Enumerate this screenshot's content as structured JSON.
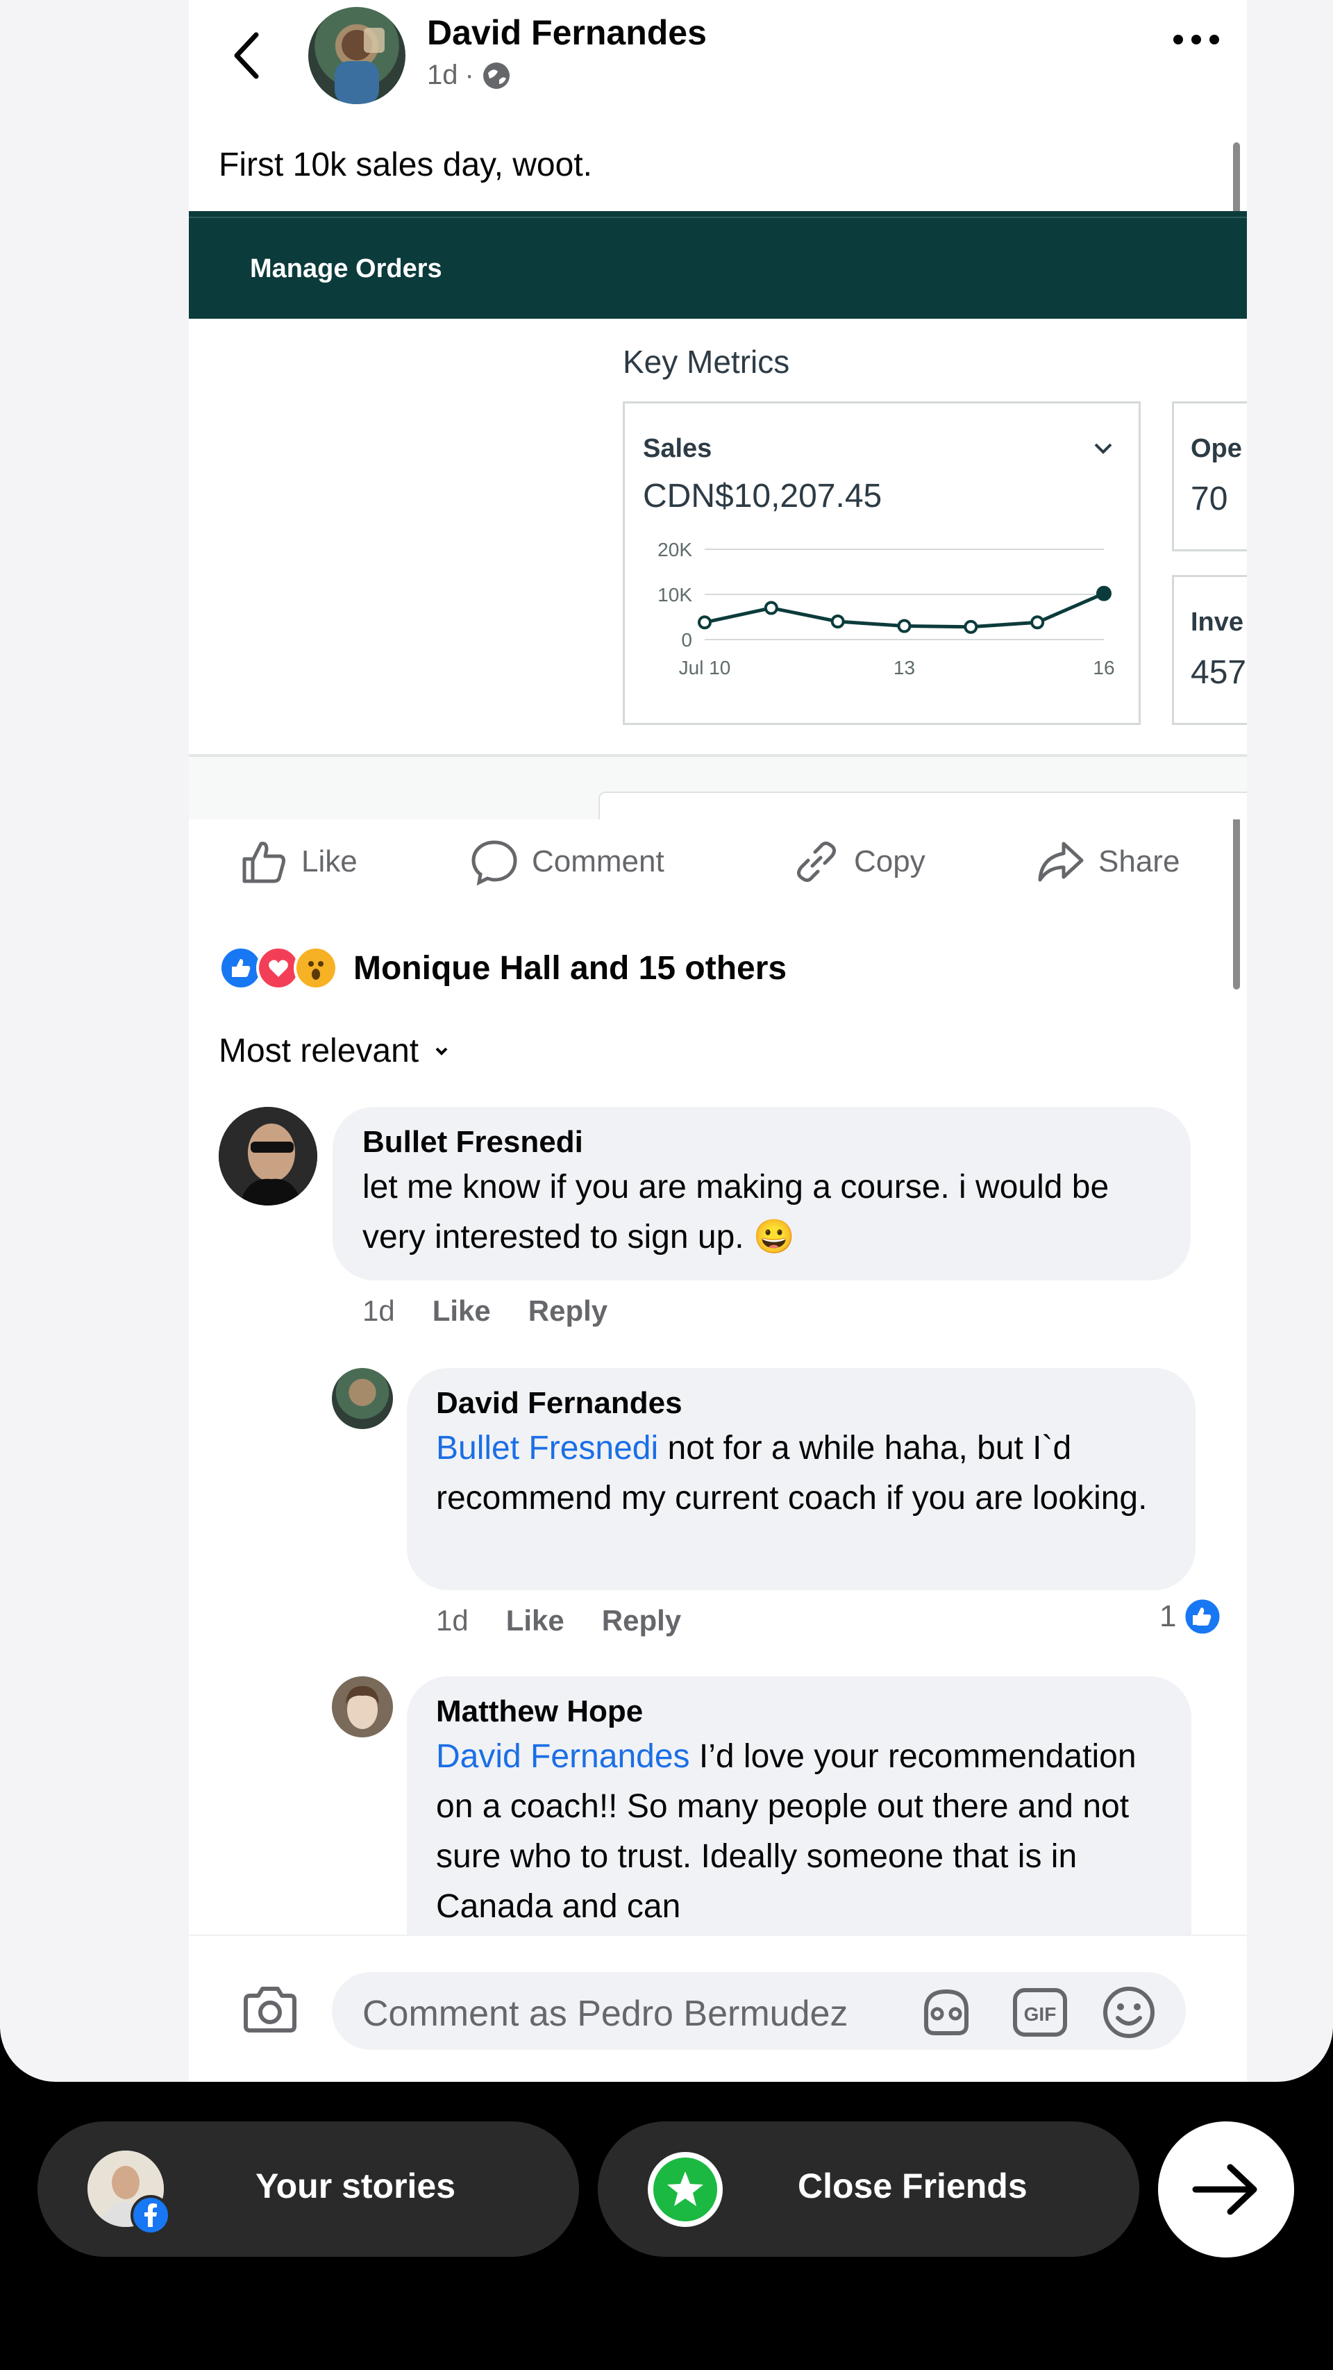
{
  "post": {
    "author": "David Fernandes",
    "time": "1d",
    "text": "First 10k sales day, woot.",
    "screenshot": {
      "header": "Manage Orders",
      "key_metrics_title": "Key Metrics",
      "sales_label": "Sales",
      "sales_value": "CDN$10,207.45",
      "side_cards": [
        {
          "label": "Ope",
          "value": "70"
        },
        {
          "label": "Inve",
          "value": "457"
        }
      ]
    }
  },
  "actions": {
    "like": "Like",
    "comment": "Comment",
    "copy": "Copy",
    "share": "Share"
  },
  "reactions": {
    "text": "Monique Hall and 15 others"
  },
  "sort": {
    "label": "Most relevant"
  },
  "comments": [
    {
      "name": "Bullet Fresnedi",
      "text": "let me know if you are making a course. i would be very interested to sign up. 😀",
      "time": "1d",
      "like": "Like",
      "reply": "Reply"
    },
    {
      "name": "David Fernandes",
      "mention": "Bullet Fresnedi",
      "text": " not for a while haha, but I`d recommend my current coach if you are looking.",
      "time": "1d",
      "like": "Like",
      "reply": "Reply",
      "like_count": "1"
    },
    {
      "name": "Matthew Hope",
      "mention": "David Fernandes",
      "text": " I’d love your recommendation on a coach!! So many people out there and not sure who to trust. Ideally someone that is in Canada and can"
    }
  ],
  "composer": {
    "placeholder": "Comment as Pedro Bermudez"
  },
  "bottom": {
    "your_stories": "Your stories",
    "close_friends": "Close Friends"
  },
  "chart_data": {
    "type": "line",
    "x": [
      "Jul 10",
      "11",
      "12",
      "13",
      "14",
      "15",
      "16"
    ],
    "xtick_labels": [
      "Jul 10",
      "13",
      "16"
    ],
    "values": [
      3800,
      7000,
      4000,
      3000,
      2800,
      3800,
      10207.45
    ],
    "ytick_labels": [
      "20K",
      "10K",
      "0"
    ],
    "ylim": [
      0,
      20000
    ],
    "grid": true
  }
}
